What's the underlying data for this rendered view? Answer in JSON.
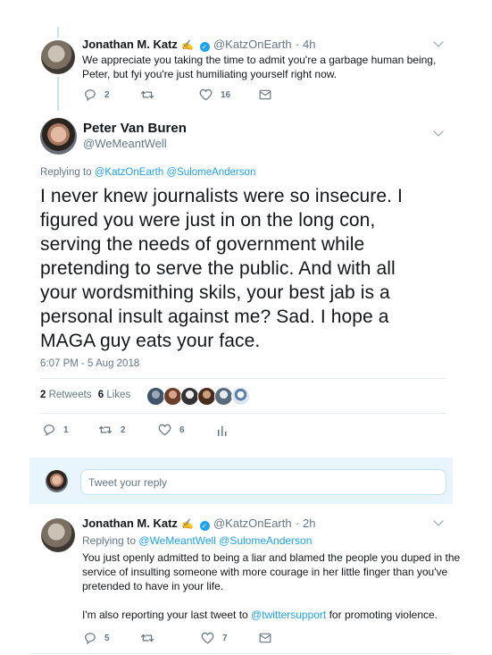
{
  "tweet1": {
    "name": "Jonathan M. Katz",
    "name_suffix": "✍",
    "handle": "@KatzOnEarth",
    "time": "· 4h",
    "text_line1": "We appreciate you taking the time to admit you're a garbage human being,",
    "text_line2": "Peter, but fyi you're just humiliating yourself right now.",
    "replies": "2",
    "likes": "16"
  },
  "main_tweet": {
    "name": "Peter Van Buren",
    "handle": "@WeMeantWell",
    "replying_label": "Replying to",
    "replying_to": "@KatzOnEarth @SulomeAnderson",
    "text_lines": [
      "I never knew journalists were so insecure. I",
      "figured you were just in on the long con,",
      "serving the needs of government while",
      "pretending to serve the public. And with all",
      "your wordsmithing skils, your best jab is a",
      "personal insult against me? Sad. I hope a",
      "MAGA guy eats your face."
    ],
    "timestamp": "6:07 PM - 5 Aug 2018",
    "retweets_count": "2",
    "retweets_label": "Retweets",
    "likes_count": "6",
    "likes_label": "Likes",
    "replies": "1",
    "retweets": "2",
    "likes": "6"
  },
  "reply_box": {
    "placeholder": "Tweet your reply"
  },
  "tweet3": {
    "name": "Jonathan M. Katz",
    "name_suffix": "✍",
    "handle": "@KatzOnEarth",
    "time": "· 2h",
    "replying_label": "Replying to",
    "replying_to": "@WeMeantWell @SulomeAnderson",
    "text_line1": "You just openly admitted to being a liar and blamed the people you duped in the",
    "text_line2": "service of insulting someone with more courage in her little finger than you've",
    "text_line3": "pretended to have in your life.",
    "text_line4_pre": "I'm also reporting your last tweet to ",
    "text_line4_link": "@twittersupport",
    "text_line4_post": " for promoting violence.",
    "replies": "5",
    "likes": "7"
  },
  "colors": {
    "accent": "#1da1f2",
    "text": "#14171a",
    "muted": "#657786",
    "border": "#e6ecf0"
  }
}
